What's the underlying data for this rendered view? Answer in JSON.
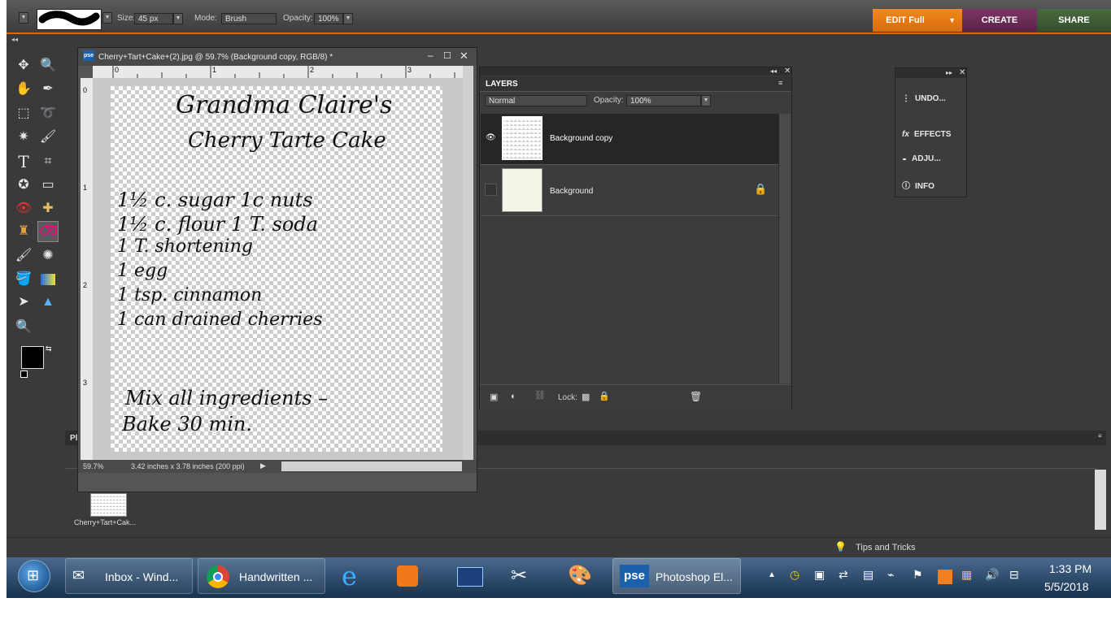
{
  "options_bar": {
    "size_label": "Size:",
    "size_value": "45 px",
    "mode_label": "Mode:",
    "mode_value": "Brush",
    "opacity_label": "Opacity:",
    "opacity_value": "100%"
  },
  "mode_buttons": {
    "edit": "EDIT Full",
    "create": "CREATE",
    "share": "SHARE"
  },
  "document": {
    "title": "Cherry+Tart+Cake+(2).jpg @ 59.7% (Background copy, RGB/8) *",
    "app_badge": "pse",
    "zoom": "59.7%",
    "doc_size": "3.42 inches x 3.78 inches (200 ppi)",
    "ruler_top": [
      "0",
      "1",
      "2",
      "3"
    ],
    "ruler_left": [
      "0",
      "1",
      "2",
      "3"
    ]
  },
  "recipe": {
    "title_line1": "Grandma Claire's",
    "title_line2": "Cherry Tarte Cake",
    "lines": [
      "1½ c. sugar    1c nuts",
      "1½ c. flour    1 T. soda",
      "1 T. shortening",
      "1 egg",
      "1 tsp. cinnamon",
      "1 can drained cherries",
      "Mix all ingredients –",
      "Bake 30 min."
    ]
  },
  "layers_panel": {
    "title": "LAYERS",
    "blend_mode": "Normal",
    "opacity_label": "Opacity:",
    "opacity_value": "100%",
    "layers": [
      {
        "name": "Background copy"
      },
      {
        "name": "Background"
      }
    ],
    "lock_label": "Lock:"
  },
  "palette_panel": {
    "items": [
      "UNDO...",
      "EFFECTS",
      "ADJU...",
      "INFO"
    ]
  },
  "project_bin": {
    "label": "Pl",
    "thumb_caption": "Cherry+Tart+Cak..."
  },
  "status_bar": {
    "tips": "Tips and Tricks"
  },
  "taskbar": {
    "items": [
      "Inbox - Wind...",
      "Handwritten ...",
      "Photoshop El..."
    ],
    "time": "1:33 PM",
    "date": "5/5/2018"
  },
  "colors": {
    "accent_orange": "#d96a0c",
    "create_purple": "#6b2a55",
    "share_green": "#3f5a35"
  }
}
